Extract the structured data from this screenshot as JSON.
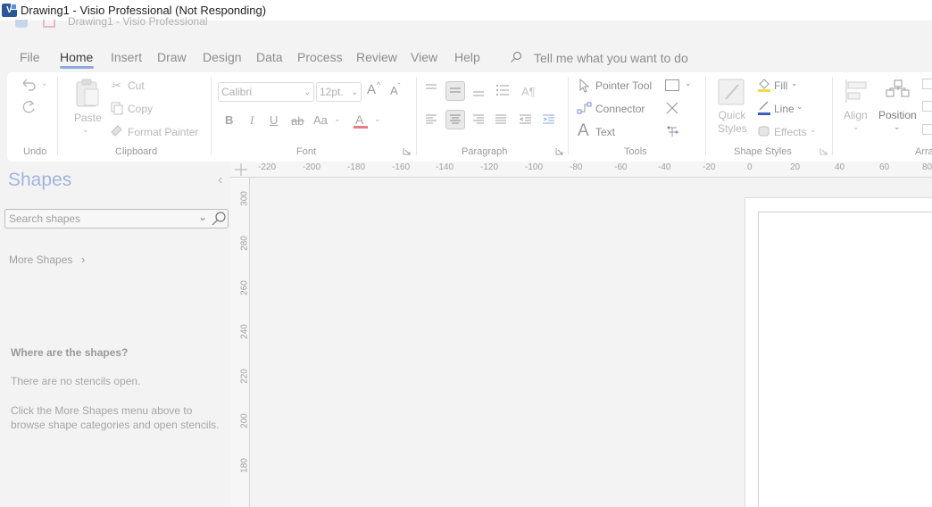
{
  "window": {
    "title": "Drawing1 - Visio Professional (Not Responding)",
    "ghost_title": "Drawing1  -  Visio Professional",
    "app_badge": "V"
  },
  "menu": {
    "tabs": [
      "File",
      "Home",
      "Insert",
      "Draw",
      "Design",
      "Data",
      "Process",
      "Review",
      "View",
      "Help"
    ],
    "active_tab": "Home",
    "tell_me_placeholder": "Tell me what you want to do"
  },
  "ribbon": {
    "groups": {
      "undo": "Undo",
      "clipboard": "Clipboard",
      "font": "Font",
      "paragraph": "Paragraph",
      "tools": "Tools",
      "shape_styles": "Shape Styles",
      "arrange": "Arra"
    },
    "clipboard": {
      "paste": "Paste",
      "cut": "Cut",
      "copy": "Copy",
      "format_painter": "Format Painter"
    },
    "font": {
      "family": "Calibri",
      "size": "12pt.",
      "bold": "B",
      "italic": "I",
      "underline": "U",
      "strike": "ab",
      "case": "Aa",
      "color_glyph": "A",
      "grow": "A",
      "shrink": "A"
    },
    "tools": {
      "pointer": "Pointer Tool",
      "connector": "Connector",
      "text": "Text",
      "text_glyph": "A"
    },
    "shape_styles": {
      "quick_styles": "Quick Styles",
      "fill": "Fill",
      "line": "Line",
      "effects": "Effects"
    },
    "arrange": {
      "align": "Align",
      "position": "Position"
    }
  },
  "shapes_pane": {
    "title": "Shapes",
    "search_placeholder": "Search shapes",
    "more_shapes": "More Shapes",
    "where_title": "Where are the shapes?",
    "no_stencils": "There are no stencils open.",
    "click_more": "Click the More Shapes menu above to browse shape categories and open stencils."
  },
  "rulers": {
    "horizontal": [
      "-220",
      "-200",
      "-180",
      "-160",
      "-140",
      "-120",
      "-100",
      "-80",
      "-60",
      "-40",
      "-20",
      "0",
      "20",
      "40",
      "60",
      "80"
    ],
    "vertical": [
      "300",
      "280",
      "260",
      "240",
      "220",
      "200",
      "180"
    ]
  },
  "colors": {
    "accent": "#8eaadb",
    "app_blue": "#2b579a",
    "fill_yellow": "#f5d94a",
    "line_blue": "#3b5fc0",
    "font_red": "#d9534f"
  }
}
